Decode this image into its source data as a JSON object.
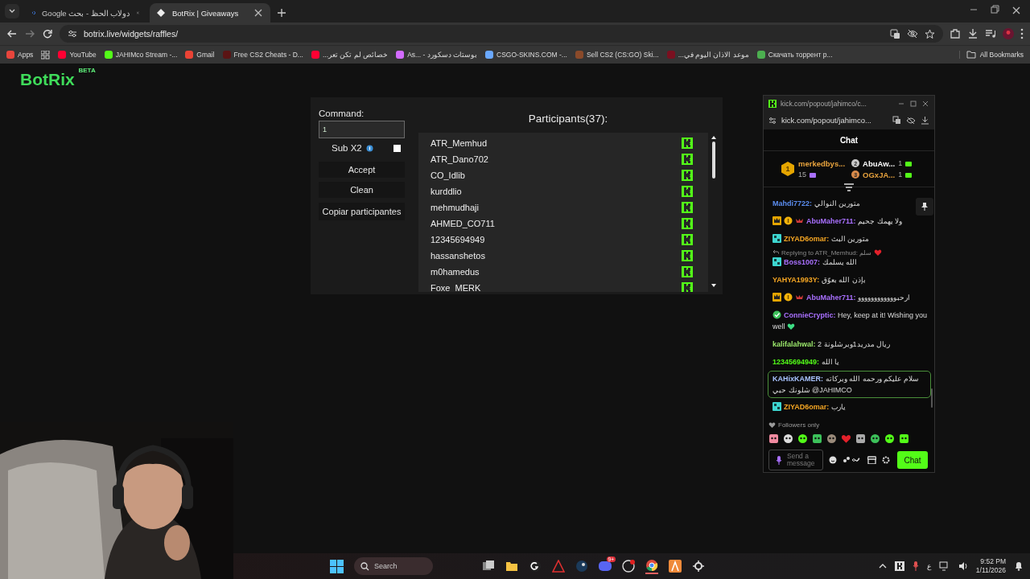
{
  "browser": {
    "tabs": [
      {
        "title": "دولاب الحظ - بحث Google",
        "selected": false
      },
      {
        "title": "BotRix | Giveaways",
        "selected": true
      }
    ],
    "url": "botrix.live/widgets/raffles/",
    "bookmarks": [
      {
        "label": "Apps",
        "color": "#e8453c"
      },
      {
        "label": "YouTube",
        "color": "#ff0033"
      },
      {
        "label": "JAHIMco Stream -...",
        "color": "#53fc18"
      },
      {
        "label": "Gmail",
        "color": "#ea4335"
      },
      {
        "label": "Free CS2 Cheats - D...",
        "color": "#5a1414"
      },
      {
        "label": "خصائص لم تكن تعر...",
        "color": "#ff0033"
      },
      {
        "label": "As... - بوستات دسكورد",
        "color": "#d36bff"
      },
      {
        "label": "CSGO-SKINS.COM -...",
        "color": "#6aa8ff"
      },
      {
        "label": "Sell CS2 (CS:GO) Ski...",
        "color": "#8a4a2a"
      },
      {
        "label": "موعد الاذان اليوم في...",
        "color": "#7a1020"
      },
      {
        "label": "Скачать торрент р...",
        "color": "#4caf50"
      }
    ],
    "all_bookmarks": "All Bookmarks"
  },
  "page": {
    "logo": "BotRix",
    "logo_badge": "BETA",
    "command_label": "Command:",
    "command_value": "1",
    "sub_x2": {
      "label": "Sub X2",
      "checked": false
    },
    "buttons": [
      "Accept",
      "Clean",
      "Copiar participantes"
    ],
    "participants_title": "Participants(37):",
    "participants": [
      "ATR_Memhud",
      "ATR_Dano702",
      "CO_Idlib",
      "kurddlio",
      "mehmudhaji",
      "AHMED_CO711",
      "12345694949",
      "hassanshetos",
      "m0hamedus",
      "Foxe_MERK"
    ]
  },
  "chat_window": {
    "title": "kick.com/popout/jahimco/c...",
    "url": "kick.com/popout/jahimco...",
    "header": "Chat",
    "leaders": [
      {
        "rank": "1",
        "name": "merkedbys...",
        "count": "15"
      },
      {
        "rank": "2",
        "name": "AbuAw...",
        "count": "1"
      },
      {
        "rank": "3",
        "name": "OGxJA...",
        "count": "1"
      }
    ],
    "messages": [
      {
        "user": "Mahdi7722:",
        "color": "#5b8def",
        "text": "متورين النوالي",
        "highlighted": false
      },
      {
        "user": "AbuMaher711:",
        "color": "#a970ff",
        "text": "ولا يهمك جحيم",
        "badges": [
          {
            "kind": "crown"
          },
          {
            "kind": "coin"
          },
          {
            "kind": "wings"
          }
        ],
        "highlighted": false
      },
      {
        "user": "ZIYAD6omar:",
        "color": "#f5a623",
        "text": "متورين البث",
        "badges": [
          {
            "kind": "og"
          }
        ],
        "highlighted": false
      },
      {
        "user": "Boss1007:",
        "color": "#a970ff",
        "text": "الله يسلمك",
        "badges": [
          {
            "kind": "og"
          }
        ],
        "reply": "Replying to ATR_Memhud: سلم",
        "highlighted": false
      },
      {
        "user": "YAHYA1993Y:",
        "color": "#f5a623",
        "text": "بإذن الله بعوّق",
        "highlighted": false
      },
      {
        "user": "AbuMaher711:",
        "color": "#a970ff",
        "text": "ارحبوووووووووووو",
        "badges": [
          {
            "kind": "crown"
          },
          {
            "kind": "coin"
          },
          {
            "kind": "wings"
          }
        ],
        "highlighted": false
      },
      {
        "user": "ConnieCryptic:",
        "color": "#a970ff",
        "text": "Hey, keep at it! Wishing you well",
        "badges": [
          {
            "kind": "verified"
          }
        ],
        "highlighted": false
      },
      {
        "user": "kalifalahwal:",
        "color": "#9be86b",
        "text": "ريال مدريد1وبرشلونة 2",
        "highlighted": false
      },
      {
        "user": "12345694949:",
        "color": "#53fc18",
        "text": "يا الله",
        "highlighted": false
      },
      {
        "user": "KAHixKAMER:",
        "color": "#a9c4ff",
        "text": "سلام عليكم ورحمه الله وبركاته شلونك حبي @JAHIMCO",
        "highlighted": true
      },
      {
        "user": "ZIYAD6omar:",
        "color": "#f5a623",
        "text": "يارب",
        "badges": [
          {
            "kind": "og"
          }
        ],
        "highlighted": false
      }
    ],
    "followers_only": "Followers only",
    "input_placeholder": "Send a message",
    "send_button": "Chat"
  },
  "taskbar": {
    "search_placeholder": "Search",
    "discord_badge": "9+",
    "language": "ع",
    "time": "9:52 PM",
    "date": "1/11/2026"
  }
}
